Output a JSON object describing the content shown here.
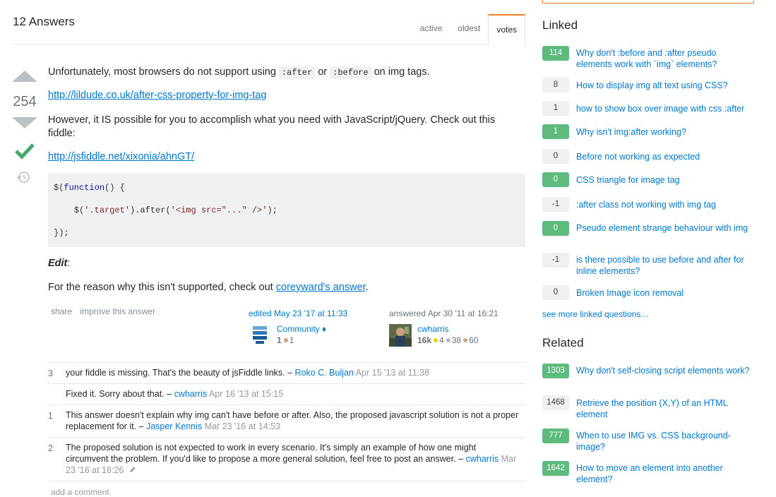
{
  "header": {
    "answers_count": "12 Answers",
    "tabs": [
      "active",
      "oldest",
      "votes"
    ],
    "active_tab": "votes"
  },
  "vote": {
    "count": "254",
    "accepted": true
  },
  "post": {
    "p1_before": "Unfortunately, most browsers do not support using",
    "code_after": ":after",
    "p1_or": "or",
    "code_before": ":before",
    "p1_end": "on img tags.",
    "link1": "http://lildude.co.uk/after-css-property-for-img-tag",
    "p2": "However, it IS possible for you to accomplish what you need with JavaScript/jQuery. Check out this fiddle:",
    "link2": "http://jsfiddle.net/xixonia/ahnGT/",
    "code": {
      "l1_a": "$(",
      "l1_kw": "function",
      "l1_b": "() {",
      "l2_a": "    $(",
      "l2_str1": "'.target'",
      "l2_b": ").after(",
      "l2_str2": "'<img src=\"...\" />'",
      "l2_c": ");",
      "l3": "});"
    },
    "edit_label": "Edit",
    "edit_colon": ":",
    "reason_before": "For the reason why this isn't supported, check out",
    "reason_link": "coreyward's answer",
    "reason_end": "."
  },
  "post_menu": {
    "share": "share",
    "improve": "improve this answer"
  },
  "editor": {
    "action": "edited May 23 '17 at 11:33",
    "name": "Community",
    "mod_mark": "♦",
    "rep": "1",
    "badge_count": "1"
  },
  "answerer": {
    "action": "answered Apr 30 '11 at 16:21",
    "name": "cwharris",
    "rep": "16k",
    "gold": "4",
    "silver": "38",
    "bronze": "60"
  },
  "comments": [
    {
      "score": "3",
      "text": "your fiddle is missing. That's the beauty of jsFiddle links. –",
      "user": "Roko C. Buljan",
      "date": "Apr 15 '13 at 11:38"
    },
    {
      "score": "",
      "text": "Fixed it. Sorry about that. –",
      "user": "cwharris",
      "date": "Apr 16 '13 at 15:15"
    },
    {
      "score": "1",
      "text": "This answer doesn't explain why img can't have before or after. Also, the proposed javascript solution is not a proper replacement for it. –",
      "user": "Jasper Kennis",
      "date": "Mar 23 '16 at 14:53"
    },
    {
      "score": "2",
      "text": "The proposed solution is not expected to work in every scenario. It's simply an example of how one might circumvent the problem. If you'd like to propose a more general solution, feel free to post an answer. –",
      "user": "cwharris",
      "date": "Mar 23 '16 at 16:26"
    }
  ],
  "add_comment": "add a comment",
  "sidebar": {
    "linked_title": "Linked",
    "linked": [
      {
        "score": "114",
        "answered": true,
        "title": "Why don't :before and :after pseudo elements work with `img` elements?"
      },
      {
        "score": "8",
        "answered": false,
        "title": "How to display img alt text using CSS?"
      },
      {
        "score": "1",
        "answered": false,
        "title": "how to show box over image with css :after"
      },
      {
        "score": "1",
        "answered": true,
        "title": "Why isn't img:after working?"
      },
      {
        "score": "0",
        "answered": false,
        "title": "Before not working as expected"
      },
      {
        "score": "0",
        "answered": true,
        "title": "CSS triangle for image tag"
      },
      {
        "score": "-1",
        "answered": false,
        "title": ":after class not working with img tag"
      },
      {
        "score": "0",
        "answered": true,
        "title": "Pseudo element strange behaviour with img"
      },
      {
        "score": "-1",
        "answered": false,
        "title": "is there possible to use before and after for inline elements?"
      },
      {
        "score": "0",
        "answered": false,
        "title": "Broken Image icon removal"
      }
    ],
    "see_more": "see more linked questions…",
    "related_title": "Related",
    "related": [
      {
        "score": "1303",
        "answered": true,
        "title": "Why don't self-closing script elements work?"
      },
      {
        "score": "1468",
        "answered": false,
        "title": "Retrieve the position (X,Y) of an HTML element"
      },
      {
        "score": "777",
        "answered": true,
        "title": "When to use IMG vs. CSS background-image?"
      },
      {
        "score": "1642",
        "answered": true,
        "title": "How to move an element into another element?"
      }
    ]
  }
}
